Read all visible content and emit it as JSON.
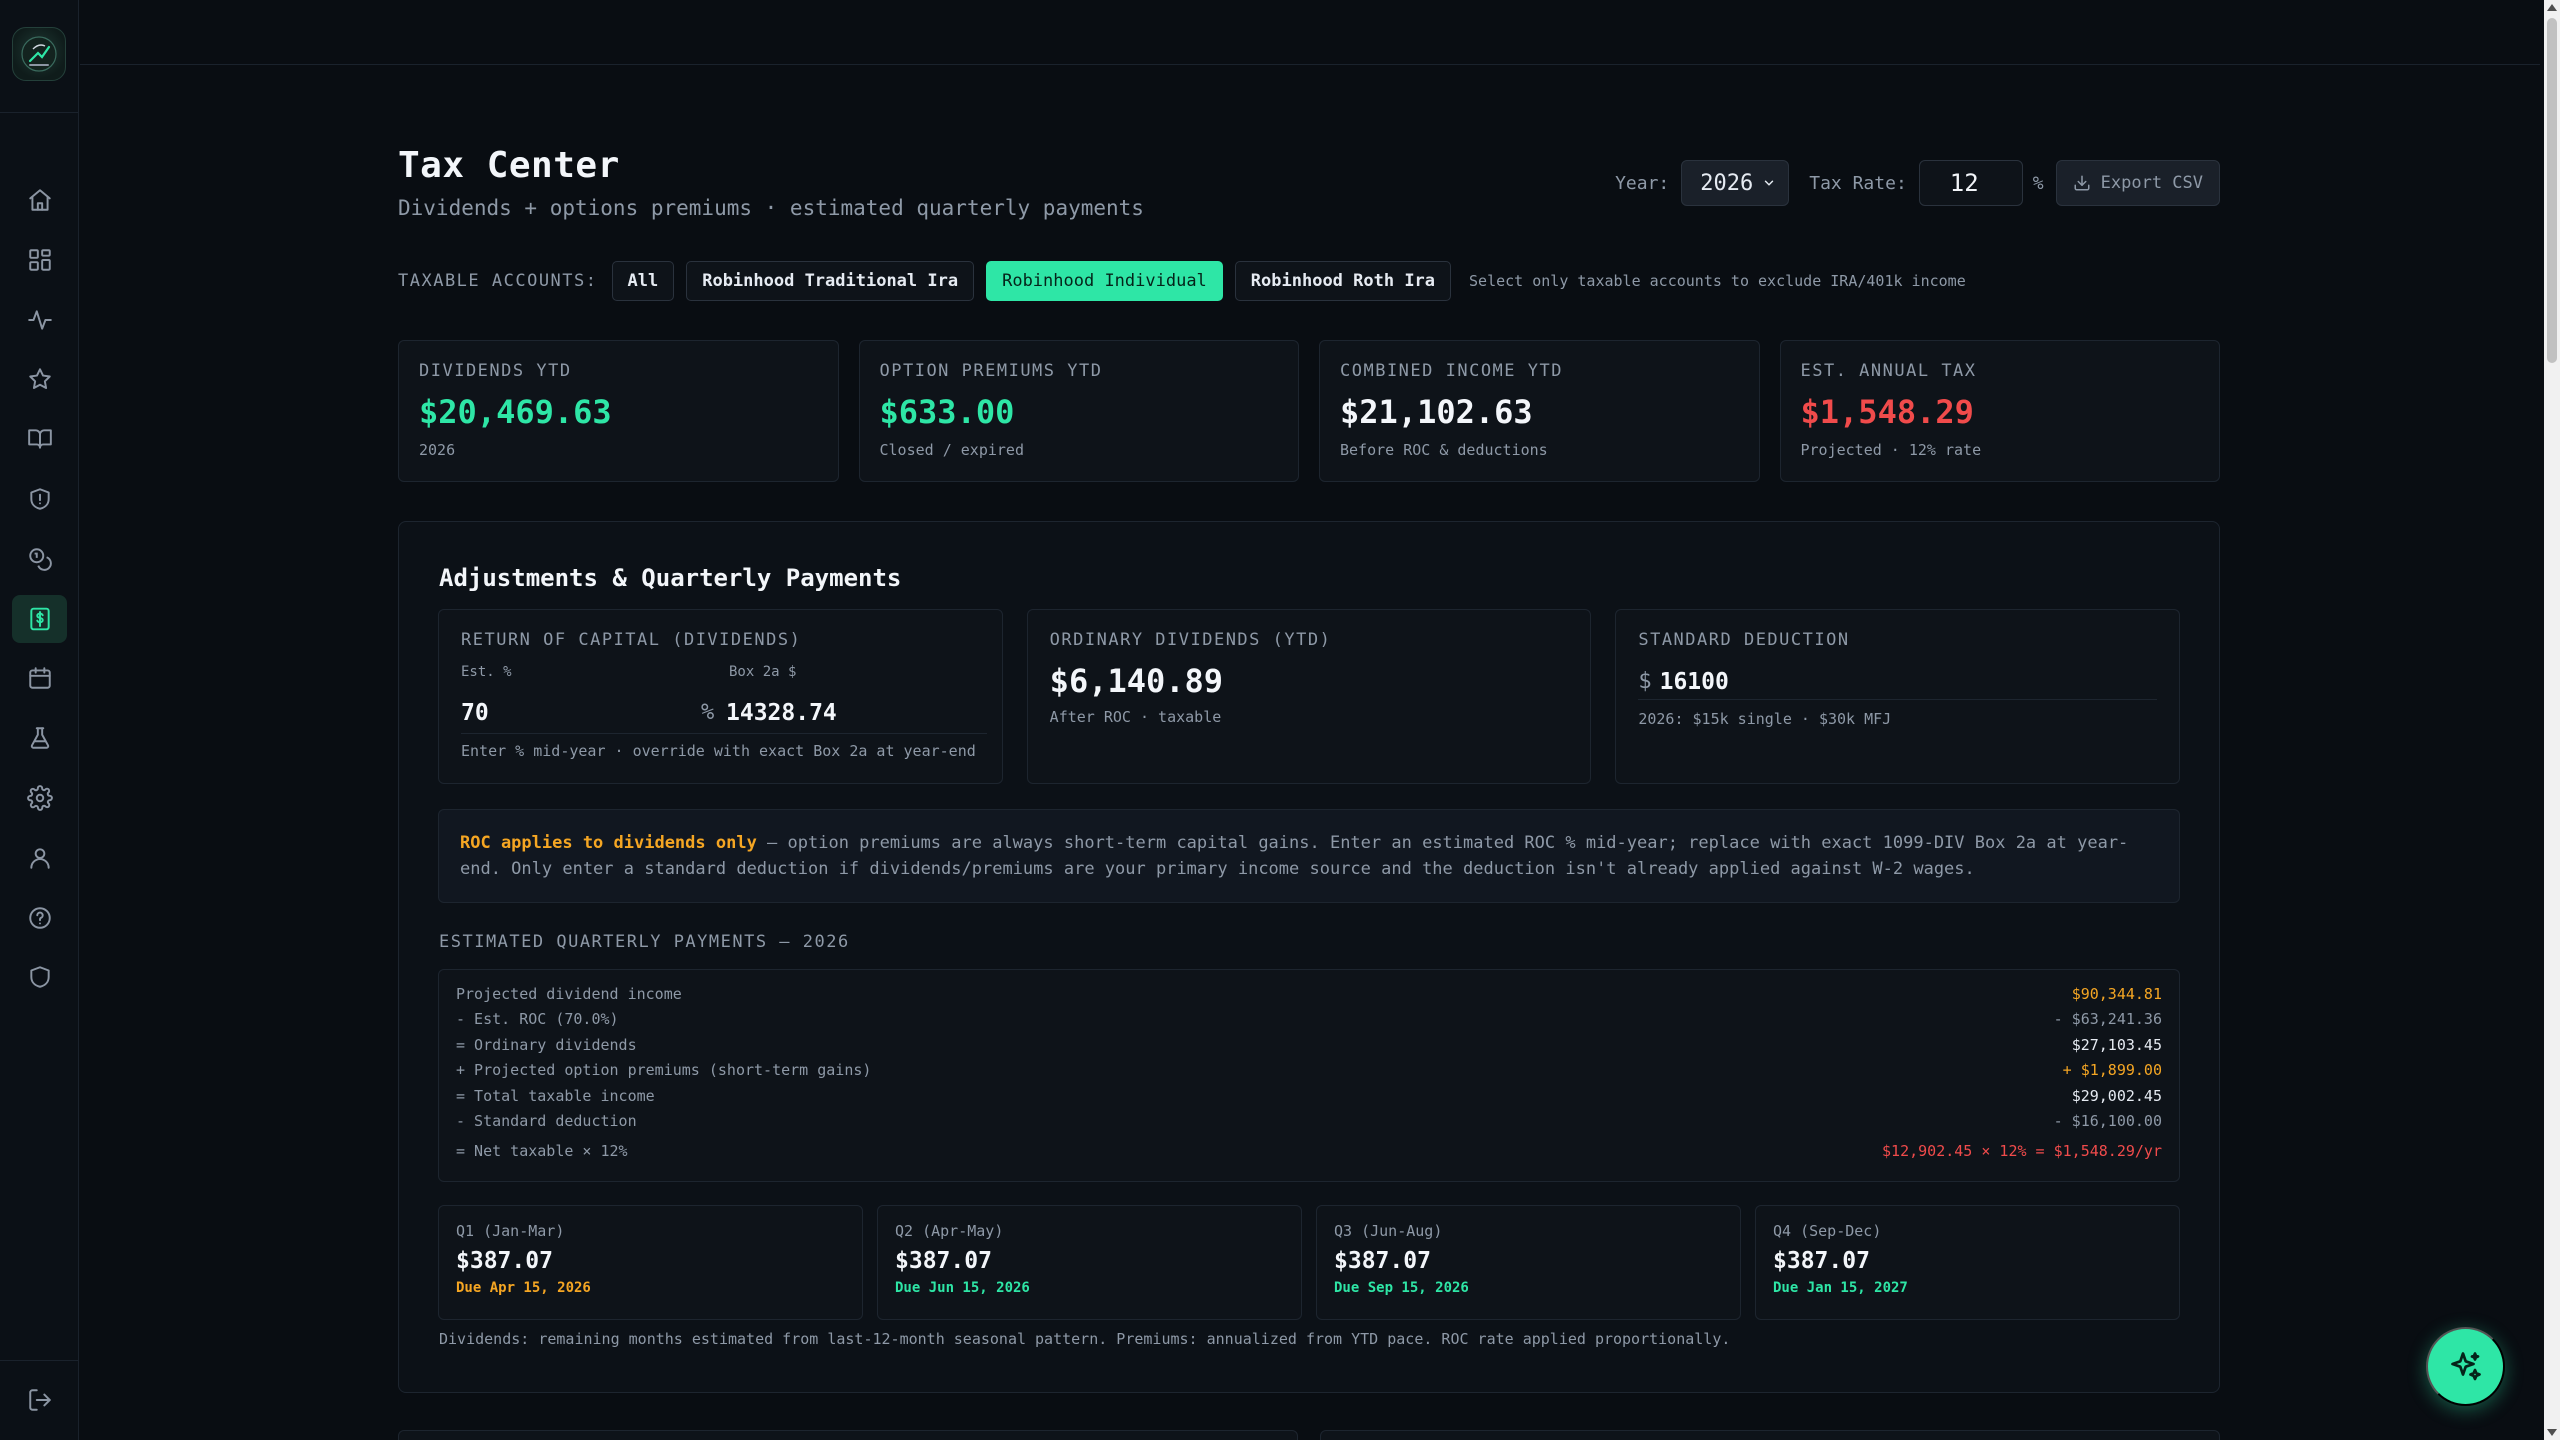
{
  "page": {
    "title": "Tax Center",
    "subtitle": "Dividends + options premiums · estimated quarterly payments"
  },
  "controls": {
    "year_label": "Year:",
    "year_value": "2026",
    "rate_label": "Tax Rate:",
    "rate_value": "12",
    "rate_unit": "%",
    "export_label": "Export CSV"
  },
  "accounts": {
    "label": "TAXABLE ACCOUNTS:",
    "chips": [
      "All",
      "Robinhood Traditional Ira",
      "Robinhood Individual",
      "Robinhood Roth Ira"
    ],
    "active": "Robinhood Individual",
    "note": "Select only taxable accounts to exclude IRA/401k income"
  },
  "cards": [
    {
      "label": "DIVIDENDS YTD",
      "value": "$20,469.63",
      "sub": "2026",
      "color": "#2ee6a6"
    },
    {
      "label": "OPTION PREMIUMS YTD",
      "value": "$633.00",
      "sub": "Closed / expired",
      "color": "#2ee6a6"
    },
    {
      "label": "COMBINED INCOME YTD",
      "value": "$21,102.63",
      "sub": "Before ROC & deductions",
      "color": "#f3f6fa"
    },
    {
      "label": "EST. ANNUAL TAX",
      "value": "$1,548.29",
      "sub": "Projected · 12% rate",
      "color": "#f04b4b"
    }
  ],
  "adjustments": {
    "title": "Adjustments & Quarterly Payments",
    "roc": {
      "label": "RETURN OF CAPITAL (DIVIDENDS)",
      "est_label": "Est. %",
      "box_label": "Box 2a $",
      "est_value": "70",
      "pct": "%",
      "box_value": "14328.74",
      "note": "Enter % mid-year · override with exact Box 2a at year-end"
    },
    "ordinary": {
      "label": "ORDINARY DIVIDENDS (YTD)",
      "value": "$6,140.89",
      "sub": "After ROC · taxable"
    },
    "standard": {
      "label": "STANDARD DEDUCTION",
      "currency": "$",
      "value": "16100",
      "note": "2026: $15k single · $30k MFJ"
    },
    "callout_bold": "ROC applies to dividends only",
    "callout_text": " — option premiums are always short-term capital gains. Enter an estimated ROC % mid-year; replace with exact 1099-DIV Box 2a at year-end. Only enter a standard deduction if dividends/premiums are your primary income source and the deduction isn't already applied against W-2 wages."
  },
  "estimate": {
    "title": "ESTIMATED QUARTERLY PAYMENTS — 2026",
    "rows": [
      {
        "label": "Projected dividend income",
        "value": "$90,344.81",
        "color": "#f5a623"
      },
      {
        "label": "- Est. ROC (70.0%)",
        "value": "- $63,241.36",
        "color": "#8e99a7"
      },
      {
        "label": "= Ordinary dividends",
        "value": "$27,103.45",
        "color": "#e6ebf2"
      },
      {
        "label": "+ Projected option premiums (short-term gains)",
        "value": "+ $1,899.00",
        "color": "#f5a623"
      },
      {
        "label": "= Total taxable income",
        "value": "$29,002.45",
        "color": "#e6ebf2"
      },
      {
        "label": "- Standard deduction",
        "value": "- $16,100.00",
        "color": "#8e99a7"
      },
      {
        "label": "= Net taxable × 12%",
        "value": "$12,902.45 × 12% = $1,548.29/yr",
        "color": "#f04b4b"
      }
    ]
  },
  "quarters": [
    {
      "label": "Q1 (Jan-Mar)",
      "value": "$387.07",
      "due": "Due Apr 15, 2026",
      "color": "#f5a623"
    },
    {
      "label": "Q2 (Apr-May)",
      "value": "$387.07",
      "due": "Due Jun 15, 2026",
      "color": "#2ee6a6"
    },
    {
      "label": "Q3 (Jun-Aug)",
      "value": "$387.07",
      "due": "Due Sep 15, 2026",
      "color": "#2ee6a6"
    },
    {
      "label": "Q4 (Sep-Dec)",
      "value": "$387.07",
      "due": "Due Jan 15, 2027",
      "color": "#2ee6a6"
    }
  ],
  "footnote": "Dividends: remaining months estimated from last-12-month seasonal pattern. Premiums: annualized from YTD pace. ROC rate applied proportionally.",
  "nav": [
    "home-icon",
    "dashboard-icon",
    "activity-icon",
    "star-icon",
    "book-icon",
    "shield-alert-icon",
    "coins-icon",
    "tax-icon",
    "calendar-icon",
    "flask-icon",
    "gear-icon",
    "user-icon",
    "help-icon",
    "shield-icon"
  ],
  "active_nav": "tax-icon"
}
